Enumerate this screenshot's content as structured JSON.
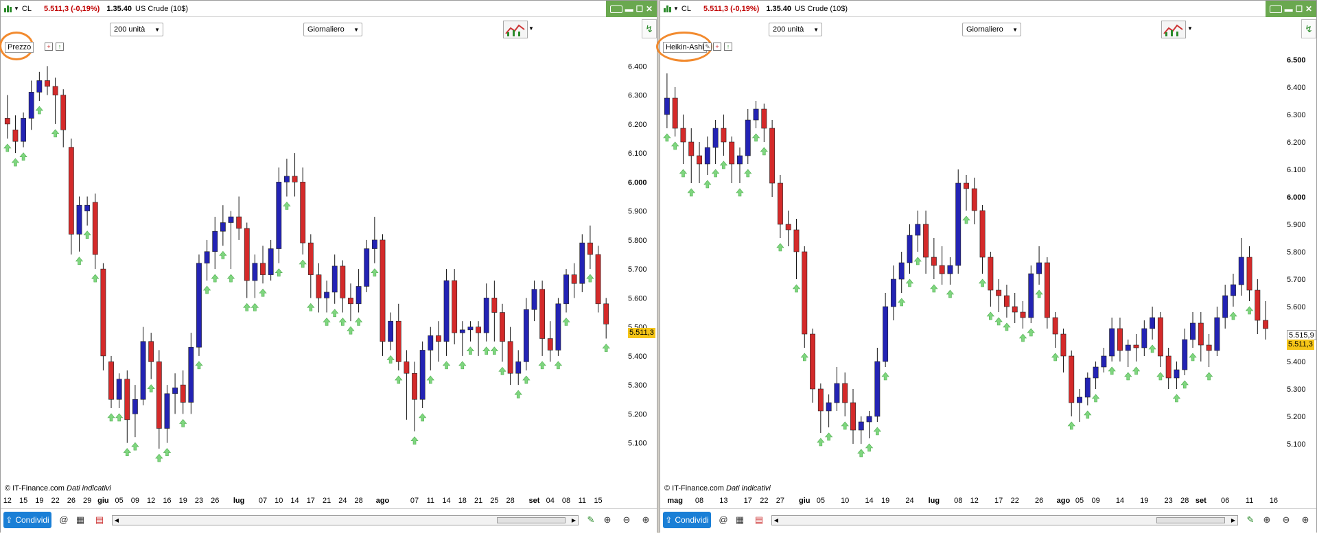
{
  "header": {
    "symbol": "CL",
    "price": "5.511,3 (-0,19%)",
    "spread": "1.35.40",
    "instrument": "US Crude (10$)"
  },
  "toolbar": {
    "units": "200 unità",
    "period": "Giornaliero"
  },
  "left_panel": {
    "chart_label": "Prezzo",
    "last_tag": "5.511,3"
  },
  "right_panel": {
    "chart_label": "Heikin-Ashi",
    "last_tag": "5.511,3",
    "ha_tag": "5.515,9"
  },
  "footer": {
    "copyright": "© IT-Finance.com",
    "disclaimer": "Dati indicativi",
    "share_label": "Condividi"
  },
  "colors": {
    "up": "#2323b4",
    "down": "#d42a2a",
    "arrow": "#7fd67f",
    "accent": "#6aa84f",
    "ellipse": "#f28a2e",
    "price_tag": "#f5c518"
  },
  "chart_data": [
    {
      "type": "candlestick",
      "ylim": [
        5.04,
        6.46
      ],
      "y_ticks": [
        "6.400",
        "6.300",
        "6.200",
        "6.100",
        "6.000",
        "5.900",
        "5.800",
        "5.700",
        "5.600",
        "5.500",
        "5.400",
        "5.300",
        "5.200",
        "5.100"
      ],
      "bold_ticks": [
        "6.000"
      ],
      "x_tick_labels": [
        {
          "i": 0,
          "t": "12"
        },
        {
          "i": 2,
          "t": "15"
        },
        {
          "i": 4,
          "t": "19"
        },
        {
          "i": 6,
          "t": "22"
        },
        {
          "i": 8,
          "t": "26"
        },
        {
          "i": 10,
          "t": "29"
        },
        {
          "i": 12,
          "t": "giu",
          "bold": true
        },
        {
          "i": 14,
          "t": "05"
        },
        {
          "i": 16,
          "t": "09"
        },
        {
          "i": 18,
          "t": "12"
        },
        {
          "i": 20,
          "t": "16"
        },
        {
          "i": 22,
          "t": "19"
        },
        {
          "i": 24,
          "t": "23"
        },
        {
          "i": 26,
          "t": "26"
        },
        {
          "i": 29,
          "t": "lug",
          "bold": true
        },
        {
          "i": 32,
          "t": "07"
        },
        {
          "i": 34,
          "t": "10"
        },
        {
          "i": 36,
          "t": "14"
        },
        {
          "i": 38,
          "t": "17"
        },
        {
          "i": 40,
          "t": "21"
        },
        {
          "i": 42,
          "t": "24"
        },
        {
          "i": 44,
          "t": "28"
        },
        {
          "i": 47,
          "t": "ago",
          "bold": true
        },
        {
          "i": 51,
          "t": "07"
        },
        {
          "i": 53,
          "t": "11"
        },
        {
          "i": 55,
          "t": "14"
        },
        {
          "i": 57,
          "t": "18"
        },
        {
          "i": 59,
          "t": "21"
        },
        {
          "i": 61,
          "t": "25"
        },
        {
          "i": 63,
          "t": "28"
        },
        {
          "i": 66,
          "t": "set",
          "bold": true
        },
        {
          "i": 68,
          "t": "04"
        },
        {
          "i": 70,
          "t": "08"
        },
        {
          "i": 72,
          "t": "11"
        },
        {
          "i": 74,
          "t": "15"
        }
      ],
      "candles": [
        [
          6.22,
          6.3,
          6.15,
          6.2
        ],
        [
          6.18,
          6.23,
          6.1,
          6.14
        ],
        [
          6.14,
          6.24,
          6.12,
          6.22
        ],
        [
          6.22,
          6.35,
          6.18,
          6.31
        ],
        [
          6.31,
          6.38,
          6.28,
          6.35
        ],
        [
          6.35,
          6.4,
          6.3,
          6.33
        ],
        [
          6.33,
          6.36,
          6.2,
          6.3
        ],
        [
          6.3,
          6.32,
          6.12,
          6.18
        ],
        [
          6.12,
          6.15,
          5.75,
          5.82
        ],
        [
          5.82,
          5.95,
          5.76,
          5.92
        ],
        [
          5.9,
          5.95,
          5.85,
          5.92
        ],
        [
          5.93,
          5.96,
          5.7,
          5.75
        ],
        [
          5.7,
          5.72,
          5.35,
          5.4
        ],
        [
          5.38,
          5.4,
          5.22,
          5.25
        ],
        [
          5.25,
          5.34,
          5.22,
          5.32
        ],
        [
          5.32,
          5.35,
          5.1,
          5.18
        ],
        [
          5.2,
          5.3,
          5.12,
          5.25
        ],
        [
          5.25,
          5.5,
          5.23,
          5.45
        ],
        [
          5.45,
          5.48,
          5.32,
          5.38
        ],
        [
          5.38,
          5.42,
          5.08,
          5.15
        ],
        [
          5.15,
          5.3,
          5.1,
          5.27
        ],
        [
          5.27,
          5.34,
          5.2,
          5.29
        ],
        [
          5.3,
          5.35,
          5.2,
          5.24
        ],
        [
          5.24,
          5.48,
          5.2,
          5.43
        ],
        [
          5.43,
          5.75,
          5.4,
          5.72
        ],
        [
          5.72,
          5.8,
          5.66,
          5.76
        ],
        [
          5.76,
          5.88,
          5.7,
          5.83
        ],
        [
          5.83,
          5.92,
          5.78,
          5.86
        ],
        [
          5.86,
          5.9,
          5.7,
          5.88
        ],
        [
          5.88,
          5.95,
          5.8,
          5.84
        ],
        [
          5.84,
          5.86,
          5.6,
          5.66
        ],
        [
          5.66,
          5.75,
          5.6,
          5.72
        ],
        [
          5.72,
          5.78,
          5.65,
          5.68
        ],
        [
          5.68,
          5.8,
          5.66,
          5.77
        ],
        [
          5.77,
          6.05,
          5.72,
          6.0
        ],
        [
          6.0,
          6.08,
          5.95,
          6.02
        ],
        [
          6.02,
          6.1,
          5.95,
          6.0
        ],
        [
          6.0,
          6.05,
          5.75,
          5.79
        ],
        [
          5.79,
          5.82,
          5.6,
          5.68
        ],
        [
          5.68,
          5.72,
          5.55,
          5.6
        ],
        [
          5.6,
          5.66,
          5.55,
          5.62
        ],
        [
          5.62,
          5.75,
          5.58,
          5.71
        ],
        [
          5.71,
          5.73,
          5.55,
          5.6
        ],
        [
          5.6,
          5.65,
          5.52,
          5.58
        ],
        [
          5.58,
          5.7,
          5.55,
          5.64
        ],
        [
          5.64,
          5.8,
          5.62,
          5.77
        ],
        [
          5.77,
          5.88,
          5.72,
          5.8
        ],
        [
          5.8,
          5.82,
          5.4,
          5.45
        ],
        [
          5.45,
          5.55,
          5.42,
          5.52
        ],
        [
          5.52,
          5.58,
          5.35,
          5.38
        ],
        [
          5.38,
          5.42,
          5.18,
          5.34
        ],
        [
          5.34,
          5.38,
          5.14,
          5.25
        ],
        [
          5.25,
          5.45,
          5.22,
          5.42
        ],
        [
          5.42,
          5.5,
          5.35,
          5.47
        ],
        [
          5.47,
          5.52,
          5.38,
          5.45
        ],
        [
          5.45,
          5.7,
          5.4,
          5.66
        ],
        [
          5.66,
          5.7,
          5.44,
          5.48
        ],
        [
          5.48,
          5.52,
          5.4,
          5.49
        ],
        [
          5.49,
          5.52,
          5.45,
          5.5
        ],
        [
          5.5,
          5.52,
          5.4,
          5.48
        ],
        [
          5.48,
          5.65,
          5.45,
          5.6
        ],
        [
          5.6,
          5.66,
          5.45,
          5.55
        ],
        [
          5.55,
          5.58,
          5.38,
          5.45
        ],
        [
          5.45,
          5.5,
          5.3,
          5.34
        ],
        [
          5.34,
          5.42,
          5.3,
          5.38
        ],
        [
          5.38,
          5.6,
          5.35,
          5.56
        ],
        [
          5.56,
          5.66,
          5.52,
          5.63
        ],
        [
          5.63,
          5.66,
          5.4,
          5.46
        ],
        [
          5.46,
          5.52,
          5.38,
          5.42
        ],
        [
          5.42,
          5.6,
          5.4,
          5.58
        ],
        [
          5.58,
          5.7,
          5.55,
          5.68
        ],
        [
          5.68,
          5.72,
          5.6,
          5.65
        ],
        [
          5.65,
          5.82,
          5.62,
          5.79
        ],
        [
          5.79,
          5.85,
          5.7,
          5.75
        ],
        [
          5.75,
          5.78,
          5.55,
          5.58
        ],
        [
          5.58,
          5.6,
          5.46,
          5.51
        ]
      ],
      "arrows": [
        0,
        1,
        2,
        4,
        6,
        9,
        10,
        11,
        13,
        14,
        15,
        16,
        18,
        19,
        20,
        22,
        24,
        25,
        26,
        27,
        28,
        30,
        31,
        32,
        34,
        35,
        37,
        38,
        40,
        41,
        42,
        43,
        44,
        46,
        48,
        49,
        51,
        52,
        53,
        55,
        57,
        58,
        60,
        61,
        62,
        64,
        65,
        67,
        69,
        70,
        73,
        75
      ]
    },
    {
      "type": "heikin-ashi",
      "ylim": [
        5.02,
        6.54
      ],
      "y_ticks": [
        "6.500",
        "6.400",
        "6.300",
        "6.200",
        "6.100",
        "6.000",
        "5.900",
        "5.800",
        "5.700",
        "5.600",
        "5.500",
        "5.400",
        "5.300",
        "5.200",
        "5.100"
      ],
      "bold_ticks": [
        "6.500",
        "6.000"
      ],
      "x_tick_labels": [
        {
          "i": 1,
          "t": "mag",
          "bold": true
        },
        {
          "i": 4,
          "t": "08"
        },
        {
          "i": 7,
          "t": "13"
        },
        {
          "i": 10,
          "t": "17"
        },
        {
          "i": 12,
          "t": "22"
        },
        {
          "i": 14,
          "t": "27"
        },
        {
          "i": 17,
          "t": "giu",
          "bold": true
        },
        {
          "i": 19,
          "t": "05"
        },
        {
          "i": 22,
          "t": "10"
        },
        {
          "i": 25,
          "t": "14"
        },
        {
          "i": 27,
          "t": "19"
        },
        {
          "i": 30,
          "t": "24"
        },
        {
          "i": 33,
          "t": "lug",
          "bold": true
        },
        {
          "i": 36,
          "t": "08"
        },
        {
          "i": 38,
          "t": "12"
        },
        {
          "i": 41,
          "t": "17"
        },
        {
          "i": 43,
          "t": "22"
        },
        {
          "i": 46,
          "t": "26"
        },
        {
          "i": 49,
          "t": "ago",
          "bold": true
        },
        {
          "i": 51,
          "t": "05"
        },
        {
          "i": 53,
          "t": "09"
        },
        {
          "i": 56,
          "t": "14"
        },
        {
          "i": 59,
          "t": "19"
        },
        {
          "i": 62,
          "t": "23"
        },
        {
          "i": 64,
          "t": "28"
        },
        {
          "i": 66,
          "t": "set",
          "bold": true
        },
        {
          "i": 69,
          "t": "06"
        },
        {
          "i": 72,
          "t": "11"
        },
        {
          "i": 75,
          "t": "16"
        }
      ],
      "candles": [
        [
          6.3,
          6.45,
          6.25,
          6.36
        ],
        [
          6.36,
          6.4,
          6.22,
          6.25
        ],
        [
          6.25,
          6.3,
          6.12,
          6.2
        ],
        [
          6.2,
          6.25,
          6.05,
          6.15
        ],
        [
          6.15,
          6.2,
          6.05,
          6.12
        ],
        [
          6.12,
          6.22,
          6.08,
          6.18
        ],
        [
          6.18,
          6.28,
          6.12,
          6.25
        ],
        [
          6.25,
          6.3,
          6.15,
          6.2
        ],
        [
          6.2,
          6.22,
          6.05,
          6.12
        ],
        [
          6.12,
          6.18,
          6.05,
          6.15
        ],
        [
          6.15,
          6.32,
          6.12,
          6.28
        ],
        [
          6.28,
          6.35,
          6.25,
          6.32
        ],
        [
          6.32,
          6.34,
          6.2,
          6.25
        ],
        [
          6.25,
          6.28,
          6.0,
          6.05
        ],
        [
          6.05,
          6.08,
          5.85,
          5.9
        ],
        [
          5.9,
          5.95,
          5.82,
          5.88
        ],
        [
          5.88,
          5.92,
          5.7,
          5.8
        ],
        [
          5.8,
          5.82,
          5.45,
          5.5
        ],
        [
          5.5,
          5.52,
          5.25,
          5.3
        ],
        [
          5.3,
          5.32,
          5.14,
          5.22
        ],
        [
          5.22,
          5.28,
          5.16,
          5.25
        ],
        [
          5.25,
          5.38,
          5.22,
          5.32
        ],
        [
          5.32,
          5.36,
          5.2,
          5.25
        ],
        [
          5.25,
          5.3,
          5.1,
          5.15
        ],
        [
          5.15,
          5.2,
          5.1,
          5.18
        ],
        [
          5.18,
          5.22,
          5.12,
          5.2
        ],
        [
          5.2,
          5.45,
          5.18,
          5.4
        ],
        [
          5.4,
          5.65,
          5.38,
          5.6
        ],
        [
          5.6,
          5.75,
          5.55,
          5.7
        ],
        [
          5.7,
          5.8,
          5.65,
          5.76
        ],
        [
          5.76,
          5.9,
          5.72,
          5.86
        ],
        [
          5.86,
          5.95,
          5.8,
          5.9
        ],
        [
          5.9,
          5.95,
          5.72,
          5.78
        ],
        [
          5.78,
          5.85,
          5.7,
          5.75
        ],
        [
          5.75,
          5.82,
          5.68,
          5.72
        ],
        [
          5.72,
          5.78,
          5.68,
          5.75
        ],
        [
          5.75,
          6.1,
          5.72,
          6.05
        ],
        [
          6.05,
          6.08,
          5.95,
          6.03
        ],
        [
          6.03,
          6.07,
          5.9,
          5.95
        ],
        [
          5.95,
          5.97,
          5.72,
          5.78
        ],
        [
          5.78,
          5.8,
          5.6,
          5.66
        ],
        [
          5.66,
          5.7,
          5.58,
          5.64
        ],
        [
          5.64,
          5.68,
          5.56,
          5.6
        ],
        [
          5.6,
          5.65,
          5.54,
          5.58
        ],
        [
          5.58,
          5.62,
          5.52,
          5.56
        ],
        [
          5.56,
          5.75,
          5.54,
          5.72
        ],
        [
          5.72,
          5.82,
          5.68,
          5.76
        ],
        [
          5.76,
          5.78,
          5.52,
          5.56
        ],
        [
          5.56,
          5.58,
          5.45,
          5.5
        ],
        [
          5.5,
          5.52,
          5.36,
          5.42
        ],
        [
          5.42,
          5.44,
          5.2,
          5.25
        ],
        [
          5.25,
          5.3,
          5.18,
          5.27
        ],
        [
          5.27,
          5.36,
          5.24,
          5.34
        ],
        [
          5.34,
          5.4,
          5.3,
          5.38
        ],
        [
          5.38,
          5.45,
          5.36,
          5.42
        ],
        [
          5.42,
          5.56,
          5.4,
          5.52
        ],
        [
          5.52,
          5.56,
          5.4,
          5.44
        ],
        [
          5.44,
          5.48,
          5.38,
          5.46
        ],
        [
          5.46,
          5.5,
          5.4,
          5.45
        ],
        [
          5.45,
          5.55,
          5.42,
          5.52
        ],
        [
          5.52,
          5.6,
          5.48,
          5.56
        ],
        [
          5.56,
          5.58,
          5.38,
          5.42
        ],
        [
          5.42,
          5.45,
          5.3,
          5.34
        ],
        [
          5.34,
          5.4,
          5.3,
          5.37
        ],
        [
          5.37,
          5.52,
          5.35,
          5.48
        ],
        [
          5.48,
          5.58,
          5.45,
          5.54
        ],
        [
          5.54,
          5.58,
          5.4,
          5.46
        ],
        [
          5.46,
          5.5,
          5.38,
          5.44
        ],
        [
          5.44,
          5.6,
          5.42,
          5.56
        ],
        [
          5.56,
          5.68,
          5.52,
          5.64
        ],
        [
          5.64,
          5.72,
          5.6,
          5.68
        ],
        [
          5.68,
          5.85,
          5.64,
          5.78
        ],
        [
          5.78,
          5.82,
          5.62,
          5.66
        ],
        [
          5.66,
          5.7,
          5.5,
          5.55
        ],
        [
          5.55,
          5.62,
          5.48,
          5.52
        ]
      ],
      "arrows": [
        0,
        1,
        2,
        3,
        5,
        6,
        7,
        9,
        10,
        11,
        12,
        14,
        16,
        17,
        19,
        20,
        22,
        24,
        25,
        26,
        27,
        29,
        30,
        31,
        33,
        35,
        37,
        39,
        40,
        41,
        42,
        44,
        45,
        46,
        48,
        50,
        52,
        53,
        55,
        57,
        58,
        60,
        61,
        63,
        64,
        65,
        67,
        70,
        72
      ]
    }
  ]
}
